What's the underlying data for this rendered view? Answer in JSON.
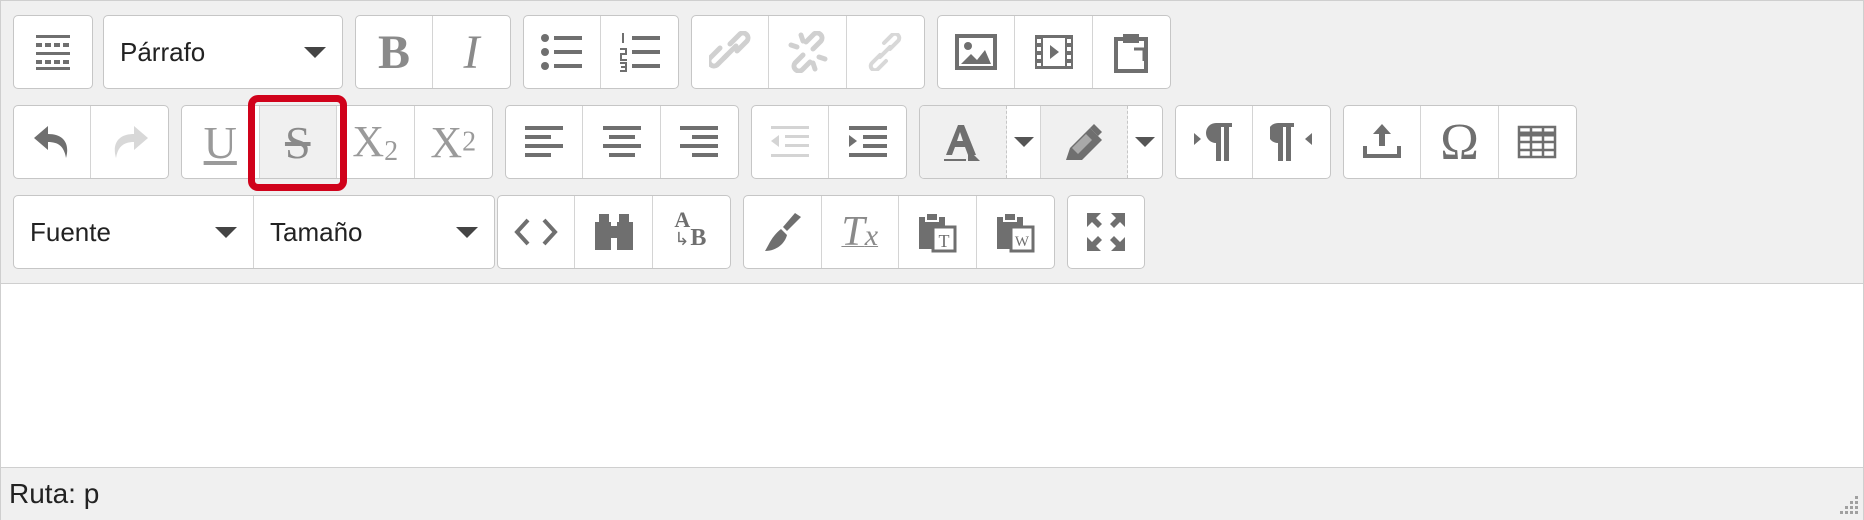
{
  "toolbar": {
    "format_select": {
      "value": "Párrafo"
    },
    "font_select": {
      "value": "Fuente"
    },
    "size_select": {
      "value": "Tamaño"
    },
    "glyphs": {
      "bold": "B",
      "italic": "I",
      "underline": "U",
      "strikethrough": "S",
      "subscript_base": "X",
      "subscript_index": "2",
      "superscript_base": "X",
      "superscript_index": "2",
      "special_char": "Ω",
      "clear_format_T": "T",
      "clear_format_x": "x",
      "find_replace_a": "A",
      "find_replace_b": "B"
    },
    "highlighted_button": "strikethrough",
    "highlight_color": "#d0021b"
  },
  "statusbar": {
    "path_text": "Ruta: p"
  }
}
